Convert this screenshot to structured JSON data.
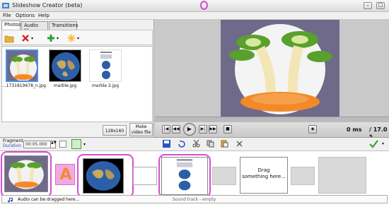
{
  "window": {
    "title": "Slideshow Creator  (beta)"
  },
  "menu": {
    "items": [
      "File",
      "Options",
      "Help"
    ]
  },
  "tabs": [
    {
      "label": "Photos",
      "active": true
    },
    {
      "label": "Audio files",
      "active": false
    },
    {
      "label": "Transitions",
      "active": false
    }
  ],
  "thumbnails": [
    {
      "label": "...1731819678_n.jpg",
      "kind": "fruit"
    },
    {
      "label": "marble.jpg",
      "kind": "globe"
    },
    {
      "label": "marble 2.jpg",
      "kind": "doc"
    }
  ],
  "buttons": {
    "resolution": "128x160",
    "make_video_line1": "Make",
    "make_video_line2": "video file"
  },
  "player": {
    "time_current": "0 ms",
    "time_total": "/ 17.0 s"
  },
  "fragment": {
    "label_line1": "Fragment",
    "label_line2": "Duration",
    "duration_value": "00:05.000"
  },
  "timeline": {
    "drag_text_line1": "Drag",
    "drag_text_line2": "something here...",
    "audio_hint": "Audio can be dragged here...",
    "sound_track": "Sound track - empty"
  },
  "colors": {
    "highlight": "#d44fd1",
    "check_green": "#3aa12f",
    "transition_orange": "#f08a3a"
  }
}
